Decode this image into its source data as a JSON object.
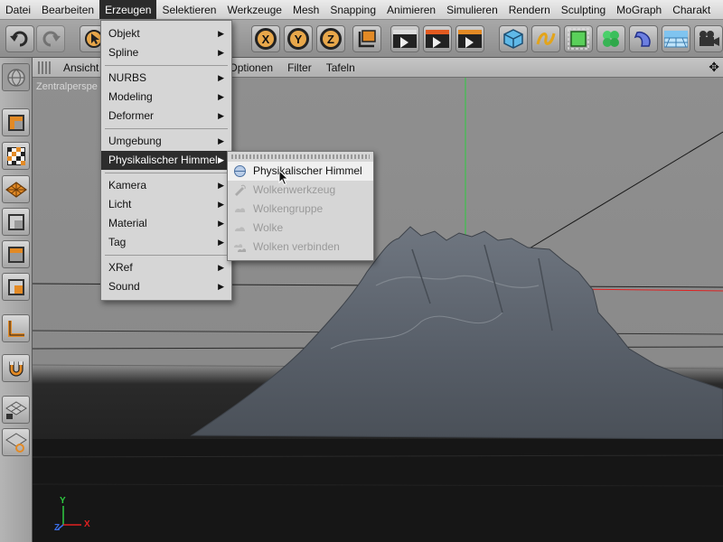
{
  "menubar": {
    "items": [
      "Datei",
      "Bearbeiten",
      "Erzeugen",
      "Selektieren",
      "Werkzeuge",
      "Mesh",
      "Snapping",
      "Animieren",
      "Simulieren",
      "Rendern",
      "Sculpting",
      "MoGraph",
      "Charakt"
    ],
    "active_index": 2
  },
  "toolbar": {
    "axis_x": "X",
    "axis_y": "Y",
    "axis_z": "Z"
  },
  "viewport_menu": {
    "items": [
      "Ansicht",
      "Optionen",
      "Filter",
      "Tafeln"
    ]
  },
  "viewport": {
    "camera_label": "Zentralperspe"
  },
  "erzeugen_menu": {
    "groups": [
      [
        "Objekt",
        "Spline"
      ],
      [
        "NURBS",
        "Modeling",
        "Deformer"
      ],
      [
        "Umgebung",
        "Physikalischer Himmel"
      ],
      [
        "Kamera",
        "Licht",
        "Material",
        "Tag"
      ],
      [
        "XRef",
        "Sound"
      ]
    ],
    "highlighted": "Physikalischer Himmel"
  },
  "sky_submenu": {
    "items": [
      {
        "label": "Physikalischer Himmel",
        "enabled": true
      },
      {
        "label": "Wolkenwerkzeug",
        "enabled": false
      },
      {
        "label": "Wolkengruppe",
        "enabled": false
      },
      {
        "label": "Wolke",
        "enabled": false
      },
      {
        "label": "Wolken verbinden",
        "enabled": false
      }
    ]
  },
  "gizmo": {
    "x": "X",
    "y": "Y",
    "z": "Z"
  },
  "colors": {
    "accent_orange": "#e38a25",
    "highlight": "#2d2d2d",
    "axis_green": "#2ecc40",
    "axis_red": "#e02020",
    "axis_blue": "#3a6ee8"
  }
}
